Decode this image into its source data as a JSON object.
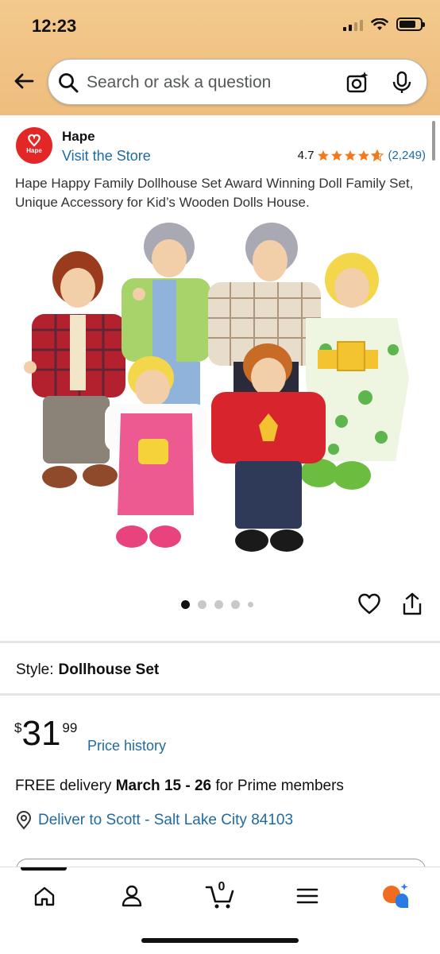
{
  "status": {
    "time": "12:23"
  },
  "search": {
    "placeholder": "Search or ask a question"
  },
  "store": {
    "brand": "Hape",
    "logo_text": "Hape",
    "visit_label": "Visit the Store",
    "rating": "4.7",
    "rating_value": 4.7,
    "review_count": "(2,249)"
  },
  "product": {
    "title": "Hape Happy Family Dollhouse Set Award Winning Doll Family Set, Unique Accessory for Kid’s Wooden Dolls House.",
    "image_count": 5,
    "active_image": 1
  },
  "style": {
    "label": "Style:",
    "value": "Dollhouse Set"
  },
  "price": {
    "currency": "$",
    "whole": "31",
    "fraction": "99",
    "history_link": "Price history"
  },
  "delivery": {
    "prefix": "FREE delivery ",
    "dates": "March 15 - 26",
    "suffix": " for Prime members",
    "deliver_to": "Deliver to Scott - Salt Lake City 84103"
  },
  "nav": {
    "cart_count": "0"
  },
  "colors": {
    "link": "#1f6aa3",
    "star": "#f27a1a",
    "header": "#f0c283",
    "brand_red": "#e32626"
  }
}
